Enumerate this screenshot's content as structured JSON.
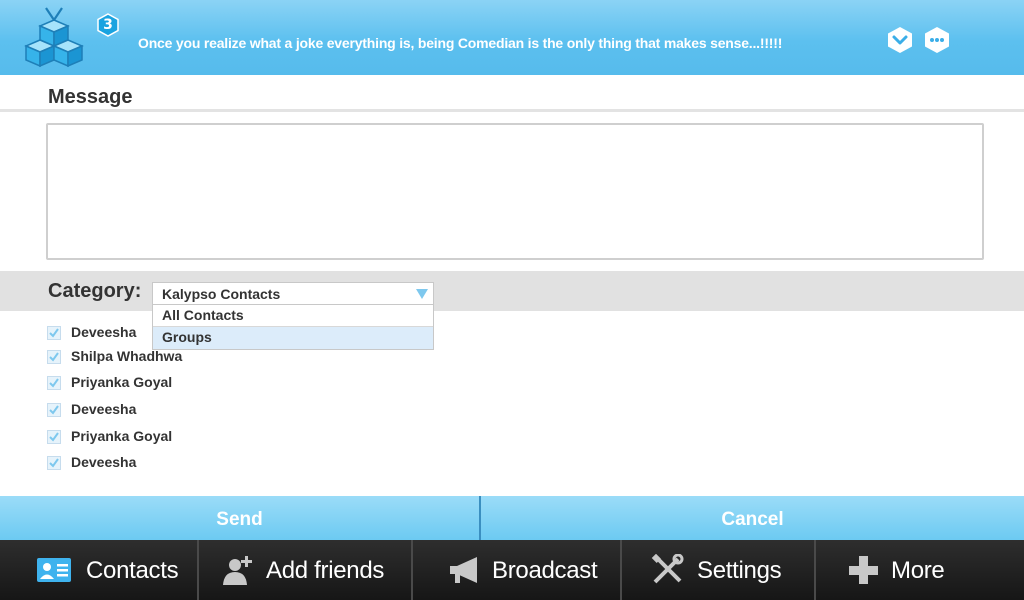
{
  "header": {
    "badge_count": "3",
    "status_message": "Once you realize what a joke everything is, being Comedian is the only thing that makes sense...!!!!!",
    "colors": {
      "header_bg": "#5cc0ef",
      "badge": "#1aa3e0"
    },
    "icons": {
      "logo": "cube-logo-icon",
      "left": "chevron-down-icon",
      "right": "chat-bubble-icon"
    }
  },
  "message": {
    "title": "Message",
    "value": ""
  },
  "category": {
    "label": "Category:",
    "selected": "Kalypso Contacts",
    "options": [
      "All Contacts",
      "Groups"
    ],
    "highlighted_option": "Groups"
  },
  "contacts": [
    {
      "name": "Deveesha",
      "checked": true
    },
    {
      "name": "Shilpa Whadhwa",
      "checked": true
    },
    {
      "name": "Priyanka Goyal",
      "checked": true
    },
    {
      "name": "Deveesha",
      "checked": true
    },
    {
      "name": "Priyanka Goyal",
      "checked": true
    },
    {
      "name": "Deveesha",
      "checked": true
    }
  ],
  "actions": {
    "send_label": "Send",
    "cancel_label": "Cancel"
  },
  "nav": {
    "items": [
      {
        "label": "Contacts",
        "icon": "contact-card-icon"
      },
      {
        "label": "Add friends",
        "icon": "add-person-icon"
      },
      {
        "label": "Broadcast",
        "icon": "megaphone-icon"
      },
      {
        "label": "Settings",
        "icon": "tools-icon"
      },
      {
        "label": "More",
        "icon": "plus-icon"
      }
    ]
  }
}
